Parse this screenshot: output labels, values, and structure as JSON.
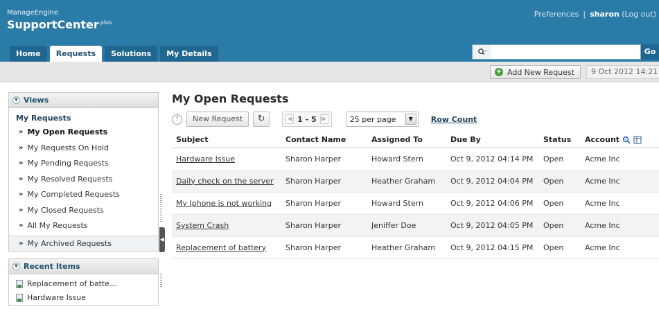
{
  "header": {
    "brand_small": "ManageEngine",
    "brand_big": "SupportCenter",
    "brand_sup": "plus",
    "preferences": "Preferences",
    "separator": "|",
    "user": "sharon",
    "logout": "(Log out)"
  },
  "tabs": [
    {
      "label": "Home"
    },
    {
      "label": "Requests"
    },
    {
      "label": "Solutions"
    },
    {
      "label": "My Details"
    }
  ],
  "search": {
    "placeholder": "",
    "value": "",
    "go_label": "Go"
  },
  "subbar": {
    "add_label": "Add New Request",
    "date": "9 Oct 2012 14:21"
  },
  "views": {
    "title": "Views",
    "section_title": "My Requests",
    "items": [
      {
        "label": "My Open Requests"
      },
      {
        "label": "My Requests On Hold"
      },
      {
        "label": "My Pending Requests"
      },
      {
        "label": "My Resolved Requests"
      },
      {
        "label": "My Completed Requests"
      },
      {
        "label": "My Closed Requests"
      },
      {
        "label": "All My Requests"
      },
      {
        "label": "My Archived Requests"
      }
    ]
  },
  "recent": {
    "title": "Recent Items",
    "items": [
      {
        "label": "Replacement of batte..."
      },
      {
        "label": "Hardware Issue"
      }
    ]
  },
  "main": {
    "title": "My Open Requests",
    "new_request": "New Request",
    "pager_text": "1 - 5",
    "per_page": "25 per page",
    "row_count": "Row Count",
    "columns": [
      "Subject",
      "Contact Name",
      "Assigned To",
      "Due By",
      "Status",
      "Account"
    ],
    "rows": [
      {
        "subject": "Hardware Issue",
        "contact": "Sharon Harper",
        "assigned": "Howard Stern",
        "due": "Oct 9, 2012 04:14 PM",
        "status": "Open",
        "account": "Acme Inc"
      },
      {
        "subject": "Daily check on the server",
        "contact": "Sharon Harper",
        "assigned": "Heather Graham",
        "due": "Oct 9, 2012 04:04 PM",
        "status": "Open",
        "account": "Acme Inc"
      },
      {
        "subject": "My Iphone is not working",
        "contact": "Sharon Harper",
        "assigned": "Howard Stern",
        "due": "Oct 9, 2012 04:06 PM",
        "status": "Open",
        "account": "Acme Inc"
      },
      {
        "subject": "System Crash",
        "contact": "Sharon Harper",
        "assigned": "Jeniffer Doe",
        "due": "Oct 9, 2012 04:05 PM",
        "status": "Open",
        "account": "Acme Inc"
      },
      {
        "subject": "Replacement of battery",
        "contact": "Sharon Harper",
        "assigned": "Heather Graham",
        "due": "Oct 9, 2012 04:15 PM",
        "status": "Open",
        "account": "Acme Inc"
      }
    ]
  },
  "colors": {
    "header_bg": "#2a7ba8",
    "tab_bg": "#1f6690",
    "add_icon": "#3fa13b"
  },
  "icons": [
    "search-icon",
    "plus-icon",
    "help-icon",
    "refresh-icon",
    "prev-page-icon",
    "next-page-icon",
    "magnifier-icon",
    "columns-icon",
    "chevron-circle-icon",
    "document-icon"
  ]
}
